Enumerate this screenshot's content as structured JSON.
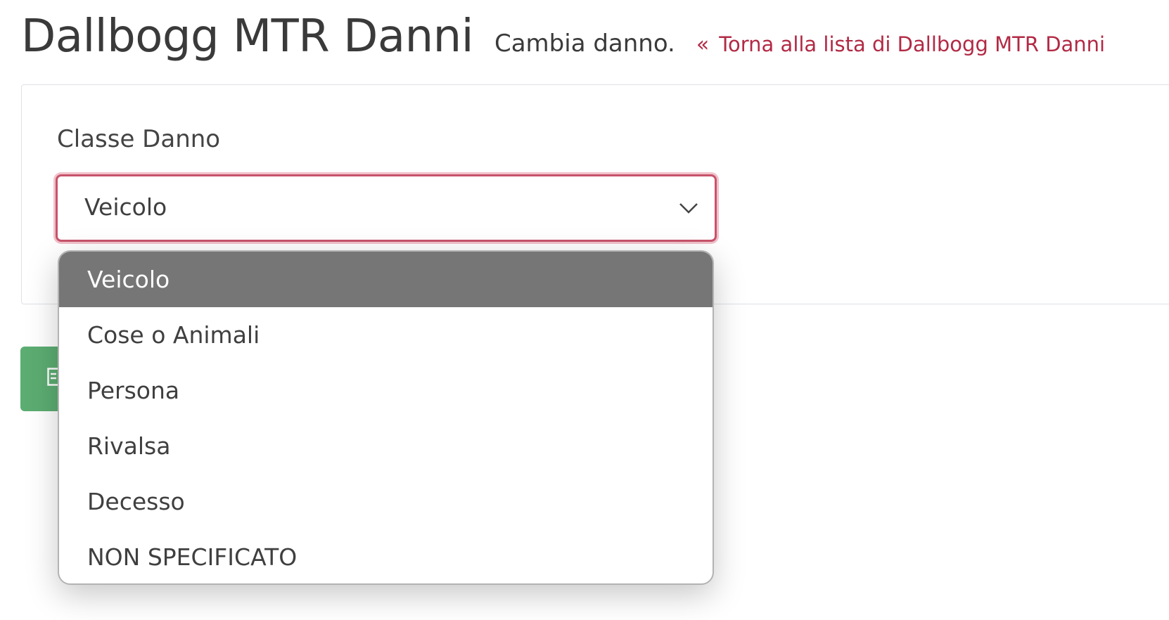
{
  "header": {
    "title": "Dallbogg MTR Danni",
    "subtitle": "Cambia danno.",
    "back_link": "Torna alla lista di Dallbogg MTR Danni",
    "back_icon": "chevrons-left-icon"
  },
  "form": {
    "field_label": "Classe Danno",
    "select_value": "Veicolo",
    "select_icon": "chevron-down-icon"
  },
  "dropdown": {
    "options": [
      {
        "label": "Veicolo",
        "selected": true
      },
      {
        "label": "Cose o Animali",
        "selected": false
      },
      {
        "label": "Persona",
        "selected": false
      },
      {
        "label": "Rivalsa",
        "selected": false
      },
      {
        "label": "Decesso",
        "selected": false
      },
      {
        "label": "NON SPECIFICATO",
        "selected": false
      }
    ]
  },
  "save_button": {
    "icon": "save-icon"
  },
  "colors": {
    "link": "#b22a45",
    "focus_border": "#c8536b",
    "selected_option_bg": "#767676",
    "save_button_bg": "#5cad72"
  }
}
